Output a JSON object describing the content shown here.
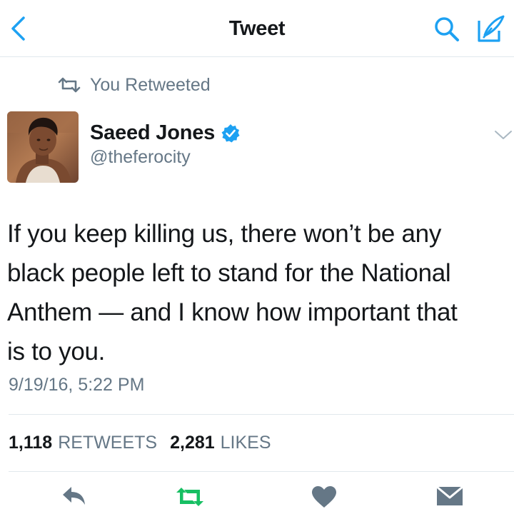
{
  "nav": {
    "title": "Tweet",
    "back_icon": "chevron-left-icon",
    "search_icon": "search-icon",
    "compose_icon": "compose-icon"
  },
  "retweet_context": {
    "label": "You Retweeted",
    "icon": "retweet-icon"
  },
  "author": {
    "name": "Saeed Jones",
    "handle": "@theferocity",
    "verified": true
  },
  "tweet": {
    "text": "If you keep killing us, there won’t be any\nblack people left to stand for the National\nAnthem — and I know how important that\nis to you.",
    "timestamp": "9/19/16, 5:22 PM"
  },
  "stats": {
    "retweets_count": "1,118",
    "retweets_label": "RETWEETS",
    "likes_count": "2,281",
    "likes_label": "LIKES"
  },
  "actions": [
    "reply-icon",
    "retweet-icon",
    "like-icon",
    "direct-message-icon"
  ],
  "colors": {
    "accent": "#1da1f2",
    "retweet_green": "#17bf63",
    "secondary_text": "#657786",
    "icon_gray": "#657786",
    "divider": "#e1e8ed"
  }
}
